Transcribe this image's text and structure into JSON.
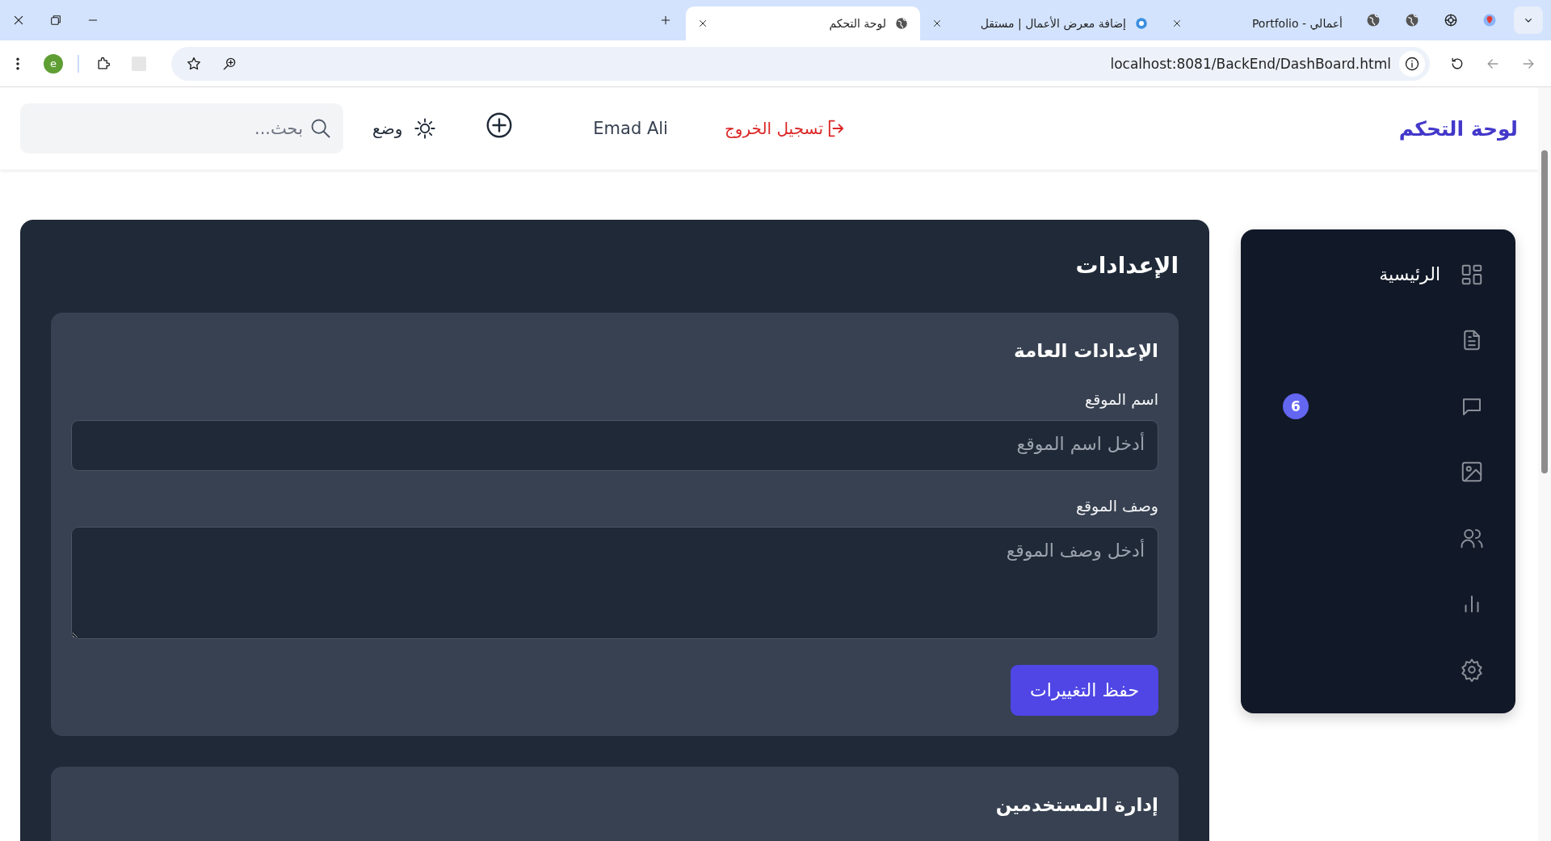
{
  "browser": {
    "tabs": [
      {
        "title": "أعمالي - Portfolio",
        "selected": false
      },
      {
        "title": "إضافة معرض الأعمال | مستقل",
        "selected": false
      },
      {
        "title": "لوحة التحكم",
        "selected": true
      }
    ],
    "profile": "e",
    "url": "localhost:8081/BackEnd/DashBoard.html"
  },
  "header": {
    "brand": "لوحة التحكم",
    "logout": "تسجيل الخروج",
    "user": "Emad Ali",
    "mode": "وضع",
    "search": {
      "placeholder": "بحث..."
    }
  },
  "sidebar": {
    "home_label": "الرئيسية",
    "messages_badge": "6"
  },
  "settings": {
    "title": "الإعدادات",
    "sections": [
      {
        "title": "الإعدادات العامة",
        "fields": [
          {
            "kind": "input",
            "label": "اسم الموقع",
            "placeholder": "أدخل اسم الموقع"
          },
          {
            "kind": "textarea",
            "label": "وصف الموقع",
            "placeholder": "أدخل وصف الموقع"
          }
        ],
        "button": "حفظ التغييرات"
      },
      {
        "title": "إدارة المستخدمين"
      }
    ]
  }
}
